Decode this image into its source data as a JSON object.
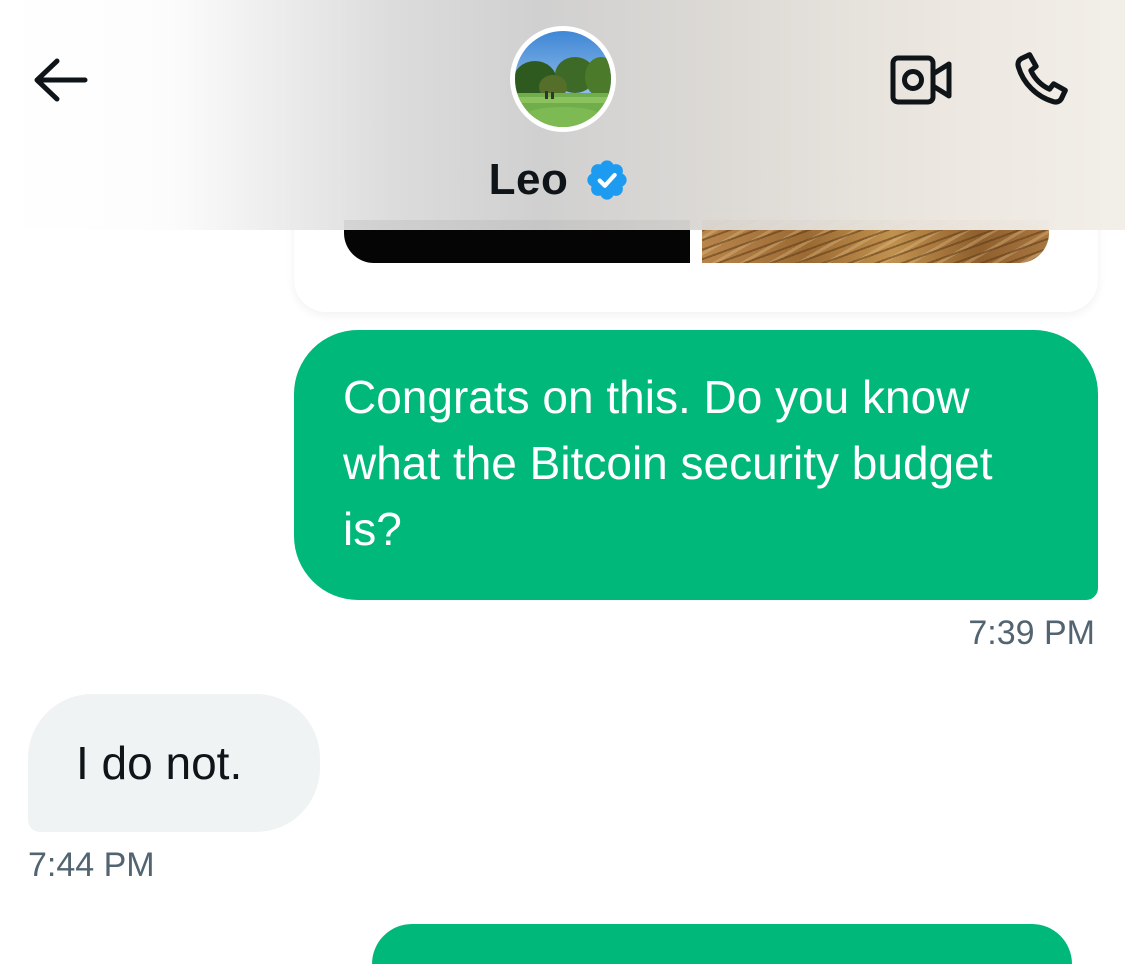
{
  "header": {
    "contact_name": "Leo",
    "icons": {
      "back": "arrow-left-icon",
      "verified": "verified-badge-icon",
      "video": "video-camera-icon",
      "call": "phone-icon"
    }
  },
  "messages": [
    {
      "direction": "outgoing",
      "text": "Congrats on this. Do you know what the Bitcoin security budget is?",
      "time": "7:39 PM"
    },
    {
      "direction": "incoming",
      "text": "I do not.",
      "time": "7:44 PM"
    }
  ],
  "colors": {
    "outgoing_bubble": "#00b87a",
    "incoming_bubble": "#eff3f4",
    "verified_badge": "#1d9bf0",
    "timestamp": "#536471",
    "text_dark": "#0f1419"
  }
}
